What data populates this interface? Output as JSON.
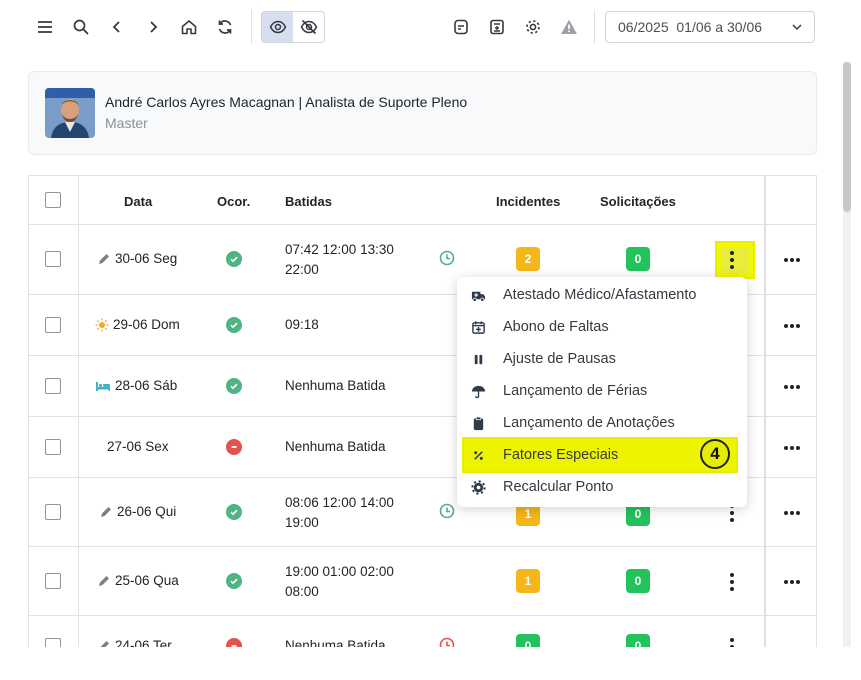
{
  "toolbar": {
    "icons": [
      "menu-icon",
      "search-icon",
      "chevron-left-icon",
      "chevron-right-icon",
      "home-icon",
      "refresh-icon",
      "eye-icon",
      "eye-off-icon",
      "document-icon",
      "calculator-icon",
      "gear-icon",
      "warning-icon"
    ],
    "period": "06/2025  01/06 a 30/06"
  },
  "user": {
    "name": "André Carlos Ayres Macagnan | Analista de Suporte Pleno",
    "role": "Master"
  },
  "table": {
    "headers": {
      "data": "Data",
      "ocor": "Ocor.",
      "batidas": "Batidas",
      "incidentes": "Incidentes",
      "solicitacoes": "Solicitações"
    },
    "rows": [
      {
        "date": "30-06 Seg",
        "date_icon": "pencil-icon",
        "ocor": "ok",
        "batidas_l1": "07:42 12:00 13:30",
        "batidas_l2": "22:00",
        "clock": "green",
        "incidentes": "2",
        "solicitacoes": "0"
      },
      {
        "date": "29-06 Dom",
        "date_icon": "sun-icon",
        "ocor": "ok",
        "batidas_l1": "09:18",
        "batidas_l2": "",
        "clock": "",
        "incidentes": "",
        "solicitacoes": ""
      },
      {
        "date": "28-06 Sáb",
        "date_icon": "bed-icon",
        "ocor": "ok",
        "batidas_l1": "Nenhuma Batida",
        "batidas_l2": "",
        "clock": "",
        "incidentes": "",
        "solicitacoes": ""
      },
      {
        "date": "27-06 Sex",
        "date_icon": "",
        "ocor": "bad",
        "batidas_l1": "Nenhuma Batida",
        "batidas_l2": "",
        "clock": "",
        "incidentes": "",
        "solicitacoes": ""
      },
      {
        "date": "26-06 Qui",
        "date_icon": "pencil-icon",
        "ocor": "ok",
        "batidas_l1": "08:06 12:00 14:00",
        "batidas_l2": "19:00",
        "clock": "green",
        "incidentes": "1",
        "solicitacoes": "0"
      },
      {
        "date": "25-06 Qua",
        "date_icon": "pencil-icon",
        "ocor": "ok",
        "batidas_l1": "19:00 01:00 02:00",
        "batidas_l2": "08:00",
        "clock": "",
        "incidentes": "1",
        "solicitacoes": "0"
      },
      {
        "date": "24-06 Ter",
        "date_icon": "pencil-icon",
        "ocor": "bad",
        "batidas_l1": "Nenhuma Batida",
        "batidas_l2": "",
        "clock": "red",
        "incidentes": "0",
        "solicitacoes": "0"
      }
    ]
  },
  "menu": {
    "items": [
      {
        "label": "Atestado Médico/Afastamento",
        "icon": "ambulance-icon"
      },
      {
        "label": "Abono de Faltas",
        "icon": "calendar-plus-icon"
      },
      {
        "label": "Ajuste de Pausas",
        "icon": "pause-icon"
      },
      {
        "label": "Lançamento de Férias",
        "icon": "umbrella-icon"
      },
      {
        "label": "Lançamento de Anotações",
        "icon": "clipboard-icon"
      },
      {
        "label": "Fatores Especiais",
        "icon": "percent-icon"
      },
      {
        "label": "Recalcular Ponto",
        "icon": "gear-icon"
      }
    ],
    "step_marker": "4"
  },
  "colors": {
    "highlight": "#eef400",
    "badge_yellow": "#f4b618",
    "badge_green": "#22c35d",
    "ok_green": "#4fb383",
    "error_red": "#e4524c"
  }
}
